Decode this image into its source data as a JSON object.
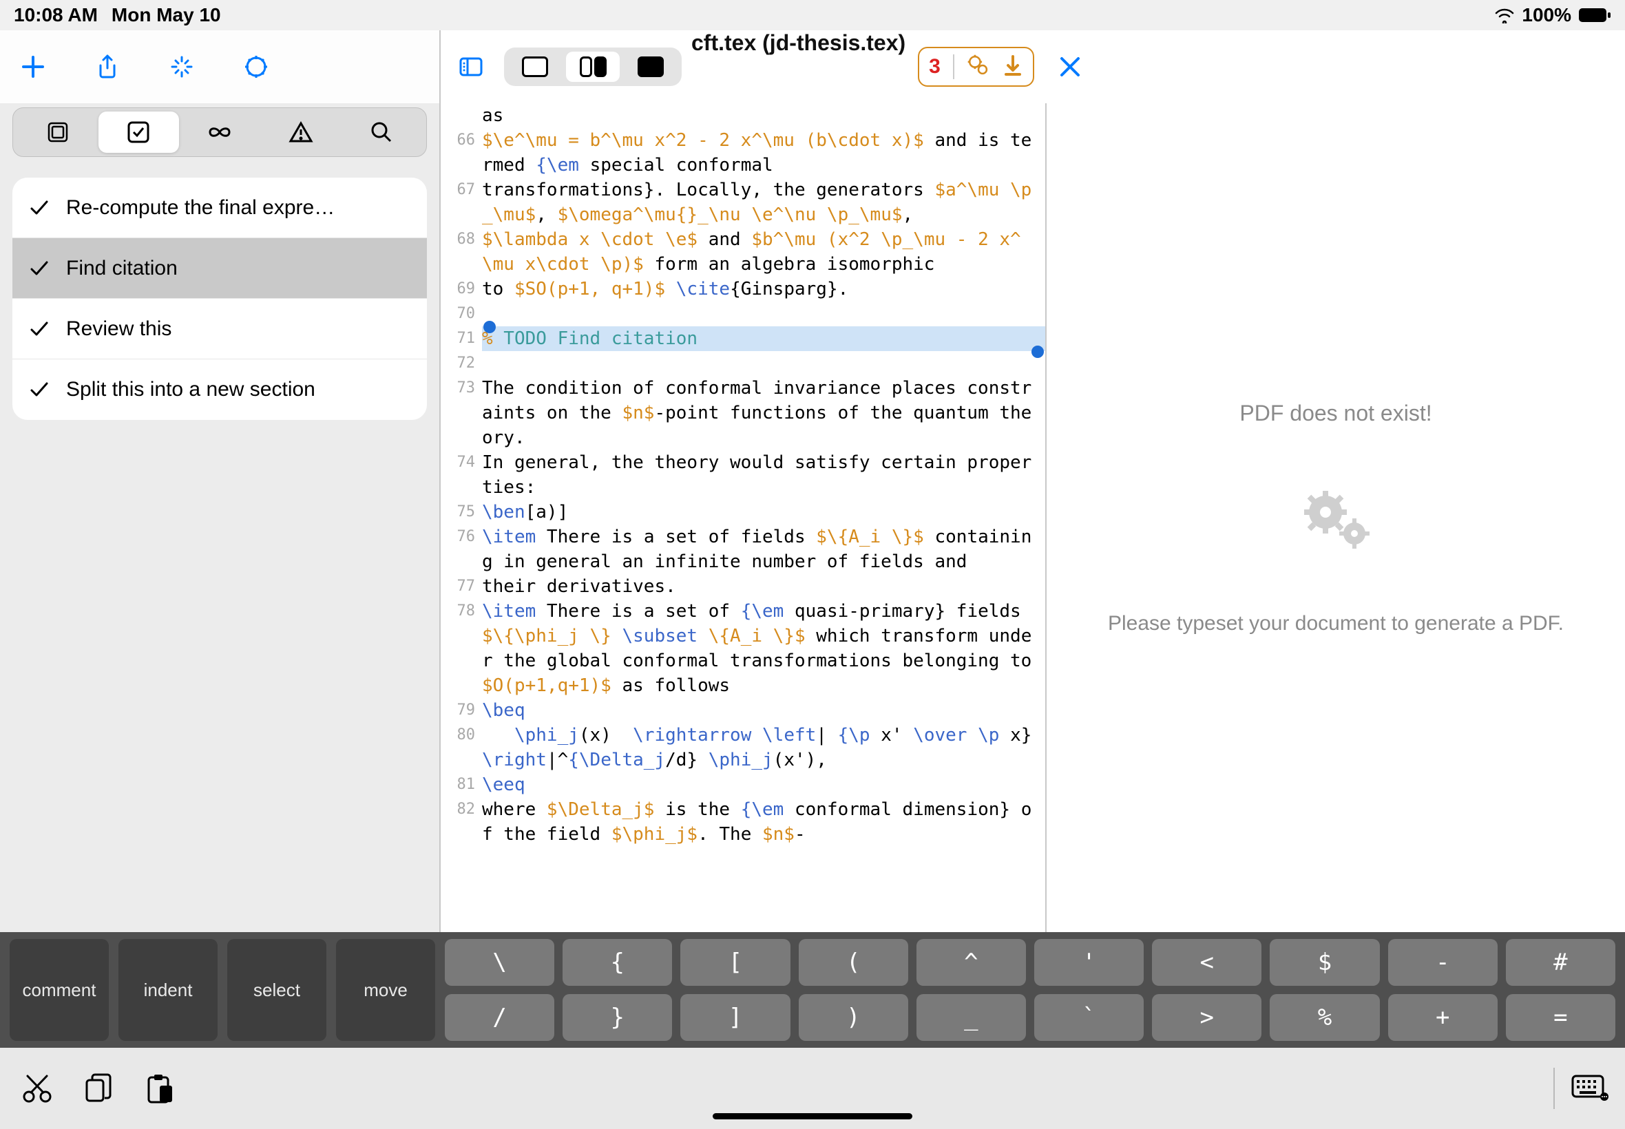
{
  "status": {
    "time": "10:08 AM",
    "date": "Mon May 10",
    "battery": "100%"
  },
  "header": {
    "title": "cft.tex (jd-thesis.tex)",
    "error_count": "3"
  },
  "todos": [
    {
      "label": "Re-compute the final expre…",
      "selected": false
    },
    {
      "label": "Find citation",
      "selected": true
    },
    {
      "label": "Review this",
      "selected": false
    },
    {
      "label": "Split this into a new section",
      "selected": false
    }
  ],
  "editor": {
    "lines": [
      {
        "n": "",
        "segs": [
          [
            "",
            "as"
          ]
        ]
      },
      {
        "n": "66",
        "segs": [
          [
            "m",
            "$\\e^\\mu = b^\\mu x^2 - 2 x^\\mu (b\\cdot x)$"
          ],
          [
            "",
            " and is termed "
          ],
          [
            "c",
            "{\\em "
          ],
          [
            "",
            "special conformal"
          ]
        ]
      },
      {
        "n": "67",
        "segs": [
          [
            "",
            "transformations}. Locally, the generators "
          ],
          [
            "m",
            "$a^\\mu \\p_\\mu$"
          ],
          [
            "",
            ", "
          ],
          [
            "m",
            "$\\omega^\\mu{}_\\nu \\e^\\nu \\p_\\mu$"
          ],
          [
            "",
            ","
          ]
        ]
      },
      {
        "n": "68",
        "segs": [
          [
            "m",
            "$\\lambda x \\cdot \\e$"
          ],
          [
            "",
            " and "
          ],
          [
            "m",
            "$b^\\mu (x^2 \\p_\\mu - 2 x^\\mu x\\cdot \\p)$"
          ],
          [
            "",
            " form an algebra isomorphic"
          ]
        ]
      },
      {
        "n": "69",
        "segs": [
          [
            "",
            "to "
          ],
          [
            "m",
            "$SO(p+1, q+1)$"
          ],
          [
            "",
            " "
          ],
          [
            "c",
            "\\cite"
          ],
          [
            "",
            "{Ginsparg}."
          ]
        ]
      },
      {
        "n": "70",
        "segs": [
          [
            "",
            ""
          ]
        ]
      },
      {
        "n": "71",
        "hl": true,
        "segs": [
          [
            "m",
            "%"
          ],
          [
            "t",
            " TODO Find citation"
          ]
        ]
      },
      {
        "n": "72",
        "segs": [
          [
            "",
            ""
          ]
        ]
      },
      {
        "n": "73",
        "segs": [
          [
            "",
            "The condition of conformal invariance places constraints on the "
          ],
          [
            "m",
            "$n$"
          ],
          [
            "",
            "-point functions of the quantum theory."
          ]
        ]
      },
      {
        "n": "74",
        "segs": [
          [
            "",
            "In general, the theory would satisfy certain properties:"
          ]
        ]
      },
      {
        "n": "75",
        "segs": [
          [
            "c",
            "\\ben"
          ],
          [
            "",
            "[a)]"
          ]
        ]
      },
      {
        "n": "76",
        "segs": [
          [
            "c",
            "\\item"
          ],
          [
            "",
            " There is a set of fields "
          ],
          [
            "m",
            "$\\{A_i \\}$"
          ],
          [
            "",
            " containing in general an infinite number of fields and"
          ]
        ]
      },
      {
        "n": "77",
        "segs": [
          [
            "",
            "their derivatives."
          ]
        ]
      },
      {
        "n": "78",
        "segs": [
          [
            "c",
            "\\item"
          ],
          [
            "",
            " There is a set of "
          ],
          [
            "c",
            "{\\em "
          ],
          [
            "",
            "quasi-primary} fields "
          ],
          [
            "m",
            "$\\{\\phi_j \\}"
          ],
          [
            "",
            " "
          ],
          [
            "c",
            "\\subset "
          ],
          [
            "m",
            "\\{A_i \\}$"
          ],
          [
            "",
            " which transform under the global conformal transformations belonging to "
          ],
          [
            "m",
            "$O(p+1,q+1)$"
          ],
          [
            "",
            " as follows"
          ]
        ]
      },
      {
        "n": "79",
        "segs": [
          [
            "c",
            "\\beq"
          ]
        ]
      },
      {
        "n": "80",
        "segs": [
          [
            "",
            "   "
          ],
          [
            "c",
            "\\phi_j"
          ],
          [
            "",
            "(x)  "
          ],
          [
            "c",
            "\\rightarrow \\left"
          ],
          [
            "",
            "| "
          ],
          [
            "c",
            "{\\p "
          ],
          [
            "",
            "x' "
          ],
          [
            "c",
            "\\over \\p "
          ],
          [
            "",
            "x} "
          ],
          [
            "c",
            "\\right"
          ],
          [
            "",
            "|^"
          ],
          [
            "c",
            "{\\Delta_j"
          ],
          [
            "",
            "/d} "
          ],
          [
            "c",
            "\\phi_j"
          ],
          [
            "",
            "(x'),"
          ]
        ]
      },
      {
        "n": "81",
        "segs": [
          [
            "c",
            "\\eeq"
          ]
        ]
      },
      {
        "n": "82",
        "segs": [
          [
            "",
            "where "
          ],
          [
            "m",
            "$\\Delta_j$"
          ],
          [
            "",
            " is the "
          ],
          [
            "c",
            "{\\em "
          ],
          [
            "",
            "conformal dimension} of the field "
          ],
          [
            "m",
            "$\\phi_j$"
          ],
          [
            "",
            ". The "
          ],
          [
            "m",
            "$n$"
          ],
          [
            "",
            "-"
          ]
        ]
      }
    ]
  },
  "pdf": {
    "msg1": "PDF does not exist!",
    "msg2": "Please typeset your document to generate a PDF."
  },
  "kbd": {
    "left": [
      "comment",
      "indent",
      "select",
      "move"
    ],
    "row1": [
      "\\",
      "{",
      "[",
      "(",
      "^",
      "'",
      "<",
      "$",
      "-",
      "#"
    ],
    "row2": [
      "/",
      "}",
      "]",
      ")",
      "_",
      "`",
      ">",
      "%",
      "+",
      "="
    ]
  }
}
